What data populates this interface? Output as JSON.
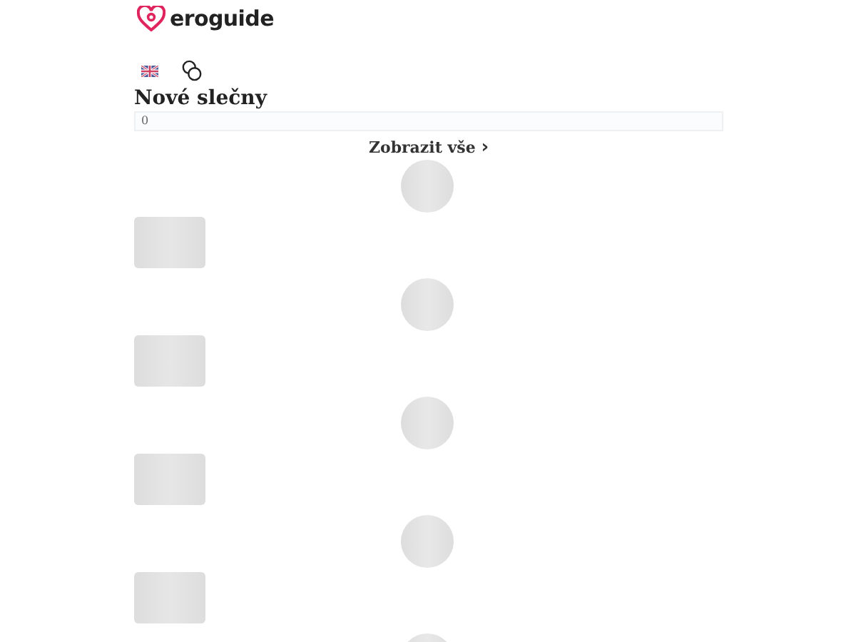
{
  "header": {
    "logo": "eroguide"
  },
  "section": {
    "title": "Nové slečny",
    "count": "0",
    "link": "Zobrazit vše",
    "link_icon": "›"
  },
  "placeholders": [
    {
      "kind": "loading"
    },
    {
      "kind": "loading"
    },
    {
      "kind": "loading"
    },
    {
      "kind": "loading"
    },
    {
      "kind": "avatar"
    }
  ]
}
